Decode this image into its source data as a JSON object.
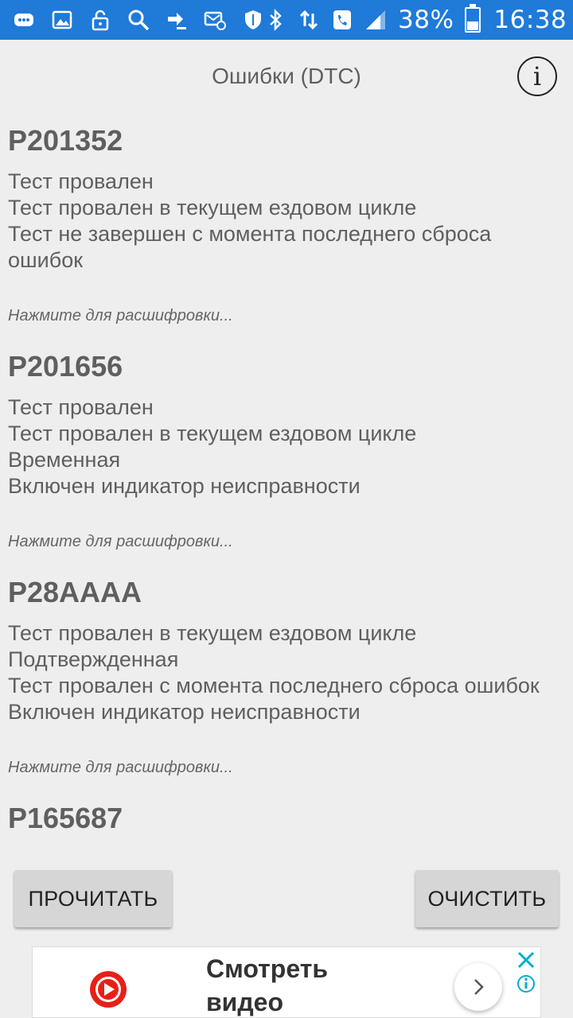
{
  "status_bar": {
    "battery_percent": "38%",
    "time": "16:38",
    "battery_level": 0.38,
    "icons": [
      "messages-icon",
      "gallery-icon",
      "lock-icon",
      "search-icon",
      "download-icon",
      "email-icon",
      "shield-icon",
      "bluetooth-icon",
      "data-arrows-icon",
      "phone-icon",
      "signal-icon",
      "battery-icon"
    ]
  },
  "header": {
    "title": "Ошибки (DTC)",
    "info_label": "i"
  },
  "errors": [
    {
      "code": "P201352",
      "lines": [
        "Тест провален",
        "Тест провален в текущем ездовом цикле",
        "Тест не завершен с момента последнего сброса ошибок"
      ],
      "hint": "Нажмите для расшифровки..."
    },
    {
      "code": "P201656",
      "lines": [
        "Тест провален",
        "Тест провален в текущем ездовом цикле",
        "Временная",
        "Включен индикатор неисправности"
      ],
      "hint": "Нажмите для расшифровки..."
    },
    {
      "code": "P28AAAA",
      "lines": [
        "Тест провален в текущем ездовом цикле",
        "Подтвержденная",
        "Тест провален с момента последнего сброса ошибок",
        "Включен индикатор неисправности"
      ],
      "hint": "Нажмите для расшифровки..."
    },
    {
      "code": "P165687",
      "lines": [],
      "hint": ""
    }
  ],
  "buttons": {
    "read_label": "ПРОЧИТАТЬ",
    "clear_label": "ОЧИСТИТЬ"
  },
  "ad": {
    "text": "Смотреть видео",
    "brand_color": "#e62117",
    "accent_color": "#00aecd"
  }
}
